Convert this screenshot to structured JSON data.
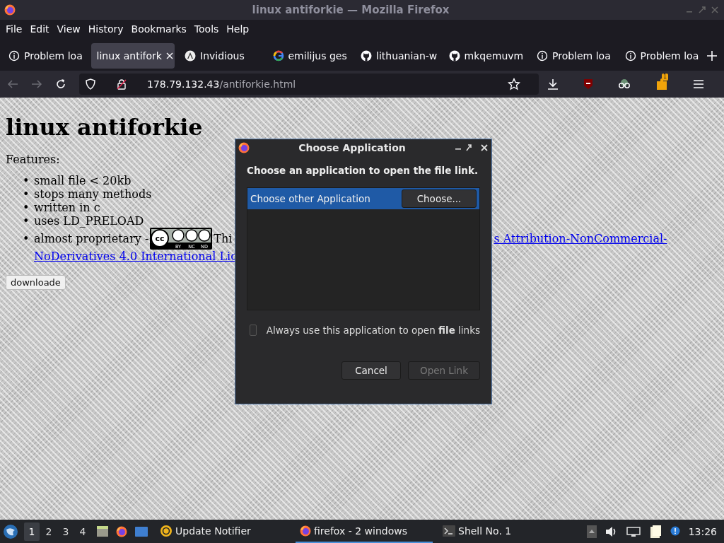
{
  "window": {
    "title": "linux antiforkie — Mozilla Firefox"
  },
  "menu": [
    "File",
    "Edit",
    "View",
    "History",
    "Bookmarks",
    "Tools",
    "Help"
  ],
  "tabs": [
    {
      "label": "Problem loa",
      "kind": "info",
      "selected": false
    },
    {
      "label": "linux antifork",
      "kind": "page",
      "selected": true
    },
    {
      "label": "Invidious",
      "kind": "invidious",
      "selected": false
    },
    {
      "label": "emilijus ges",
      "kind": "google",
      "selected": false
    },
    {
      "label": "lithuanian-w",
      "kind": "github",
      "selected": false
    },
    {
      "label": "mkqemuvm",
      "kind": "github",
      "selected": false
    },
    {
      "label": "Problem loa",
      "kind": "info",
      "selected": false
    },
    {
      "label": "Problem loa",
      "kind": "info",
      "selected": false
    }
  ],
  "address": {
    "host": "178.79.132.43",
    "path": "/antiforkie.html"
  },
  "extension_badge": "1",
  "page": {
    "heading": "linux antiforkie",
    "intro": "Features:",
    "features": [
      {
        "bullet": "•",
        "text": "small file < 20kb"
      },
      {
        "bullet": "•",
        "text": "stops many methods"
      },
      {
        "bullet": "•",
        "text": "written in c"
      },
      {
        "bullet": "•",
        "text": "uses LD_PRELOAD"
      }
    ],
    "license": {
      "bullet": "•",
      "text": "almost proprietary -",
      "badge_mark": "cc",
      "badge_labels": [
        "BY",
        "NC",
        "ND"
      ],
      "after_badge": "Thi",
      "link_right": "s Attribution-NonCommercial-",
      "link_second_line": "NoDerivatives 4.0 International Lic"
    },
    "download_button": "downloade"
  },
  "dialog": {
    "title": "Choose Application",
    "prompt": "Choose an application to open the file link.",
    "apps": [
      {
        "label": "Choose other Application",
        "selected": true,
        "button": "Choose..."
      }
    ],
    "always": {
      "label": "Always use this application to open **file** links",
      "checked": false
    },
    "buttons": [
      {
        "label": "Cancel",
        "disabled": false
      },
      {
        "label": "Open Link",
        "disabled": true
      }
    ]
  },
  "taskbar": {
    "workspaces": [
      {
        "label": "1",
        "selected": true
      },
      {
        "label": "2",
        "selected": false
      },
      {
        "label": "3",
        "selected": false
      },
      {
        "label": "4",
        "selected": false
      }
    ],
    "tasks": [
      {
        "label": "Update Notifier",
        "kind": "update",
        "selected": false
      },
      {
        "label": "firefox - 2 windows",
        "kind": "firefox",
        "selected": true
      },
      {
        "label": "Shell No. 1",
        "kind": "terminal",
        "selected": false
      }
    ],
    "clock": "13:26"
  }
}
